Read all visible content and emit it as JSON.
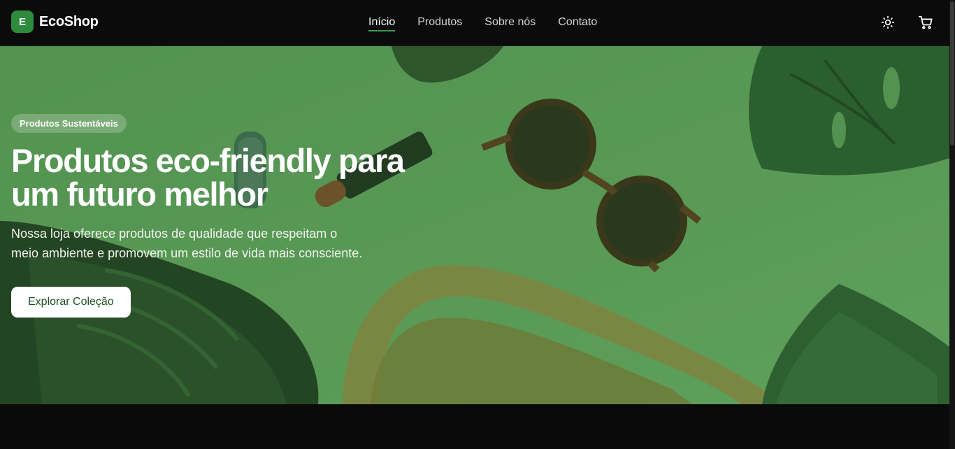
{
  "brand": {
    "logo_letter": "E",
    "name": "EcoShop"
  },
  "nav": {
    "links": [
      {
        "label": "Início",
        "active": true
      },
      {
        "label": "Produtos",
        "active": false
      },
      {
        "label": "Sobre nós",
        "active": false
      },
      {
        "label": "Contato",
        "active": false
      }
    ]
  },
  "actions": {
    "theme_icon": "sun-icon",
    "cart_icon": "shopping-cart-icon"
  },
  "hero": {
    "badge": "Produtos Sustentáveis",
    "title_line1": "Produtos eco-friendly para",
    "title_line2": "um futuro melhor",
    "description": "Nossa loja oferece produtos de qualidade que respeitam o meio ambiente e promovem um estilo de vida mais consciente.",
    "cta_label": "Explorar Coleção"
  },
  "colors": {
    "accent": "#2e8b3e",
    "hero_tint": "#5f9a5c",
    "background": "#0a0a0a"
  }
}
